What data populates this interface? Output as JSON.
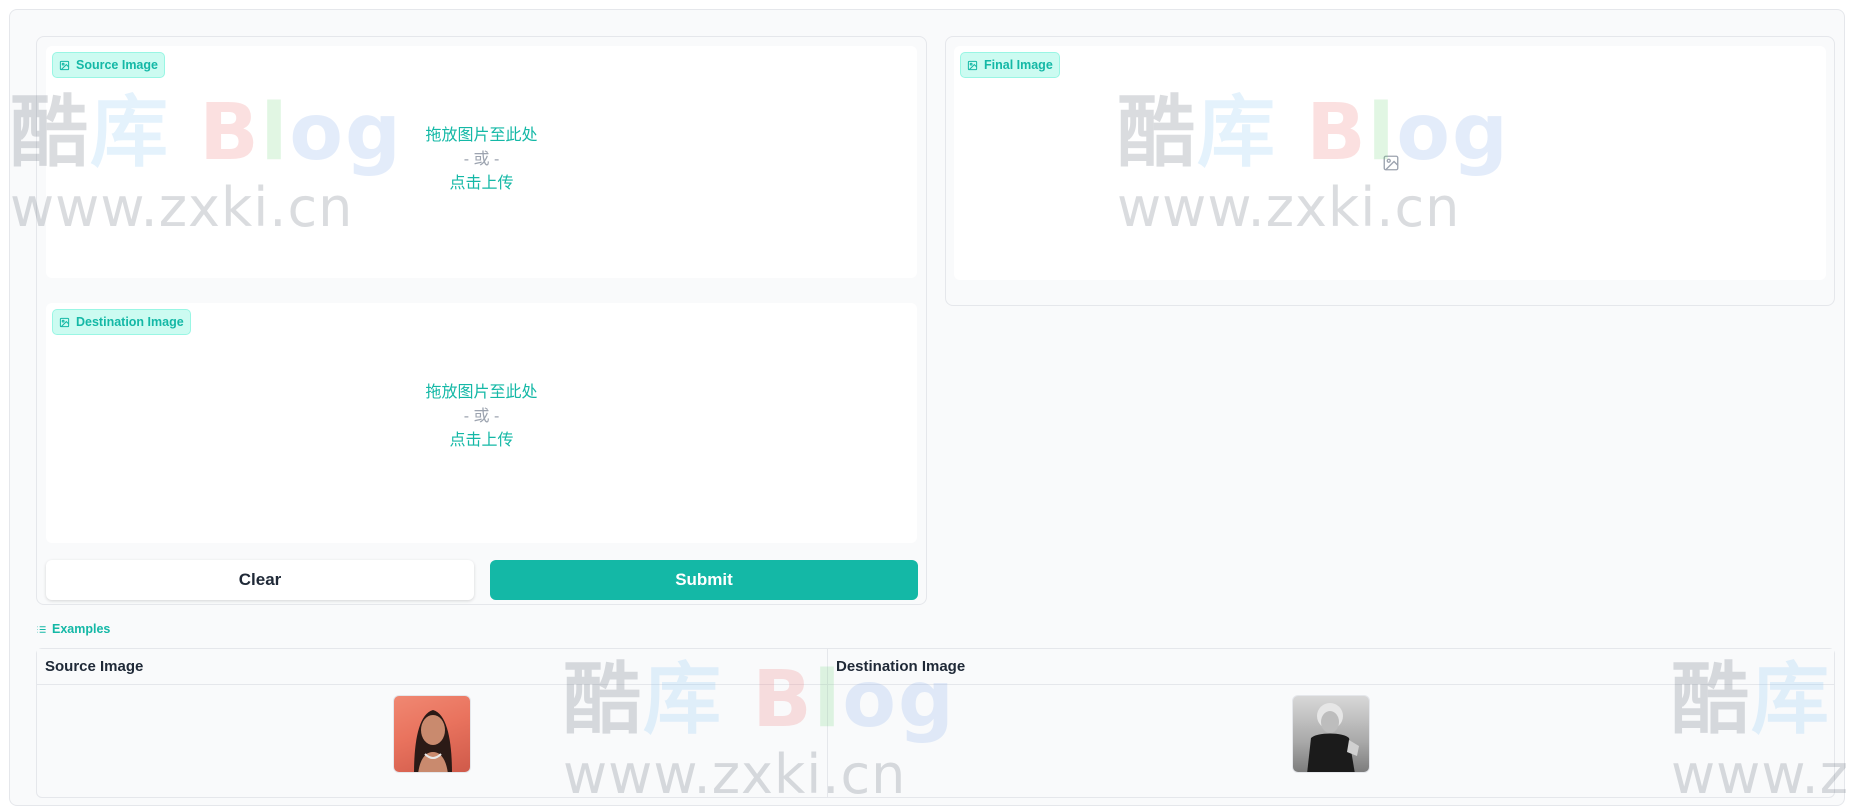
{
  "source_panel": {
    "label": "Source Image",
    "drop_text": "拖放图片至此处",
    "or_text": "- 或 -",
    "click_text": "点击上传"
  },
  "destination_panel": {
    "label": "Destination Image",
    "drop_text": "拖放图片至此处",
    "or_text": "- 或 -",
    "click_text": "点击上传"
  },
  "output_panel": {
    "label": "Final Image"
  },
  "buttons": {
    "clear": "Clear",
    "submit": "Submit"
  },
  "examples": {
    "label": "Examples",
    "headers": [
      "Source Image",
      "Destination Image"
    ]
  },
  "watermark": {
    "brand_cn1": "酷",
    "brand_cn2": "库",
    "brand_b": "B",
    "brand_l": "l",
    "brand_og": "og",
    "url": "www.zxki.cn"
  },
  "colors": {
    "accent": "#14b8a6",
    "accent_light": "#ccfbf1",
    "border": "#e5e7eb",
    "background": "#f9fafb"
  },
  "icons": [
    "image-icon",
    "list-icon"
  ]
}
